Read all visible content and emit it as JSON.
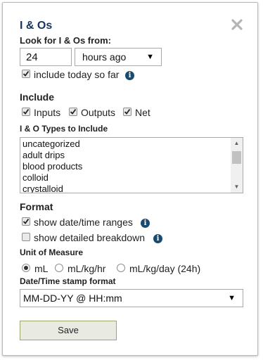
{
  "dialog": {
    "title": "I & Os",
    "close_icon": "close-x-icon"
  },
  "lookback": {
    "label": "Look for I & Os from:",
    "amount": "24",
    "unit_selected": "hours ago",
    "include_today_label": "include today so far",
    "include_today_checked": true,
    "info_icon": "i"
  },
  "include": {
    "heading": "Include",
    "inputs_label": "Inputs",
    "inputs_checked": true,
    "outputs_label": "Outputs",
    "outputs_checked": true,
    "net_label": "Net",
    "net_checked": true
  },
  "types": {
    "heading": "I & O Types to Include",
    "items": [
      "uncategorized",
      "adult drips",
      "blood products",
      "colloid",
      "crystalloid"
    ]
  },
  "format": {
    "heading": "Format",
    "show_ranges_label": "show date/time ranges",
    "show_ranges_checked": true,
    "show_breakdown_label": "show detailed breakdown",
    "show_breakdown_checked": false,
    "info_icon": "i"
  },
  "unit_of_measure": {
    "heading": "Unit of Measure",
    "options": [
      "mL",
      "mL/kg/hr",
      "mL/kg/day (24h)"
    ],
    "selected": "mL"
  },
  "timestamp_format": {
    "heading": "Date/Time stamp format",
    "selected": "MM-DD-YY @ HH:mm"
  },
  "actions": {
    "save_label": "Save"
  },
  "colors": {
    "title": "#17365d",
    "info_icon_bg": "#1a4a6e",
    "save_border": "#9aa870",
    "save_bg": "#e9ebe3"
  }
}
